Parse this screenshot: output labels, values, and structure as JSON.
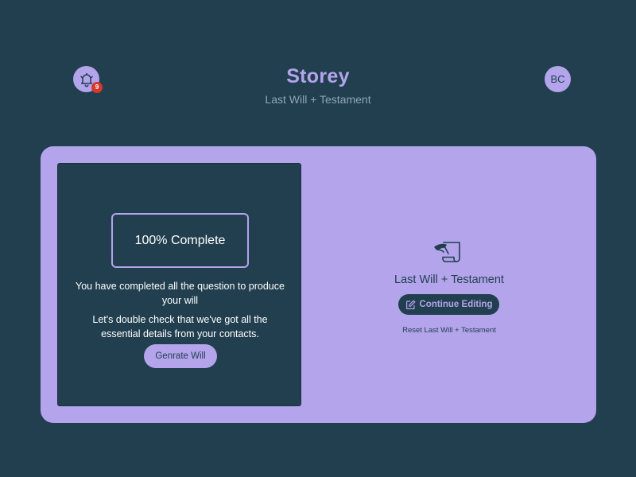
{
  "header": {
    "brand": "Storey",
    "subtitle": "Last Will + Testament",
    "notification_count": "9",
    "avatar_initials": "BC",
    "bell_icon": "bell-icon"
  },
  "status_panel": {
    "progress_text": "100% Complete",
    "progress_value": 100,
    "message_line1": "You have completed all the question to produce your will",
    "message_line2": "Let's double check that we've got all the essential details from your contacts.",
    "generate_button": "Genrate Will"
  },
  "will_panel": {
    "icon": "quill-document-icon",
    "title": "Last Will + Testament",
    "continue_button": "Continue Editing",
    "continue_icon": "edit-icon",
    "reset_link": "Reset Last Will + Testament"
  },
  "colors": {
    "background": "#213f4f",
    "accent": "#b3a4ec",
    "badge": "#d6392c",
    "subtitle": "#8fa7b6"
  }
}
